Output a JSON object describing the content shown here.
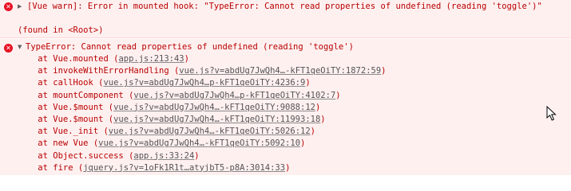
{
  "warning": {
    "message": "[Vue warn]: Error in mounted hook: \"TypeError: Cannot read properties of undefined (reading 'toggle')\"",
    "found_in": "(found in <Root>)"
  },
  "error": {
    "message": "TypeError: Cannot read properties of undefined (reading 'toggle')",
    "stack": [
      {
        "prefix": "    at Vue.mounted (",
        "link": "app.js:213:43",
        "suffix": ")"
      },
      {
        "prefix": "    at invokeWithErrorHandling (",
        "link": "vue.js?v=abdUg7JwQh4…-kFT1qeOiTY:1872:59",
        "suffix": ")"
      },
      {
        "prefix": "    at callHook (",
        "link": "vue.js?v=abdUg7JwQh4…p-kFT1qeOiTY:4236:9",
        "suffix": ")"
      },
      {
        "prefix": "    at mountComponent (",
        "link": "vue.js?v=abdUg7JwQh4…p-kFT1qeOiTY:4102:7",
        "suffix": ")"
      },
      {
        "prefix": "    at Vue.$mount (",
        "link": "vue.js?v=abdUg7JwQh4…-kFT1qeOiTY:9088:12",
        "suffix": ")"
      },
      {
        "prefix": "    at Vue.$mount (",
        "link": "vue.js?v=abdUg7JwQh4…-kFT1qeOiTY:11993:18",
        "suffix": ")"
      },
      {
        "prefix": "    at Vue._init (",
        "link": "vue.js?v=abdUg7JwQh4…-kFT1qeOiTY:5026:12",
        "suffix": ")"
      },
      {
        "prefix": "    at new Vue (",
        "link": "vue.js?v=abdUg7JwQh4…-kFT1qeOiTY:5092:10",
        "suffix": ")"
      },
      {
        "prefix": "    at Object.success (",
        "link": "app.js:33:24",
        "suffix": ")"
      },
      {
        "prefix": "    at fire (",
        "link": "jquery.js?v=1oFk1R1t…atyjbT5-p8A:3014:33",
        "suffix": ")"
      }
    ]
  },
  "icons": {
    "error": "error-circle-icon",
    "expand": "expand-triangle-icon",
    "cursor": "mouse-pointer-icon"
  },
  "colors": {
    "error_text": "#b80000",
    "error_bg": "#fff0f0",
    "error_icon": "#e81123",
    "link": "#545454"
  }
}
